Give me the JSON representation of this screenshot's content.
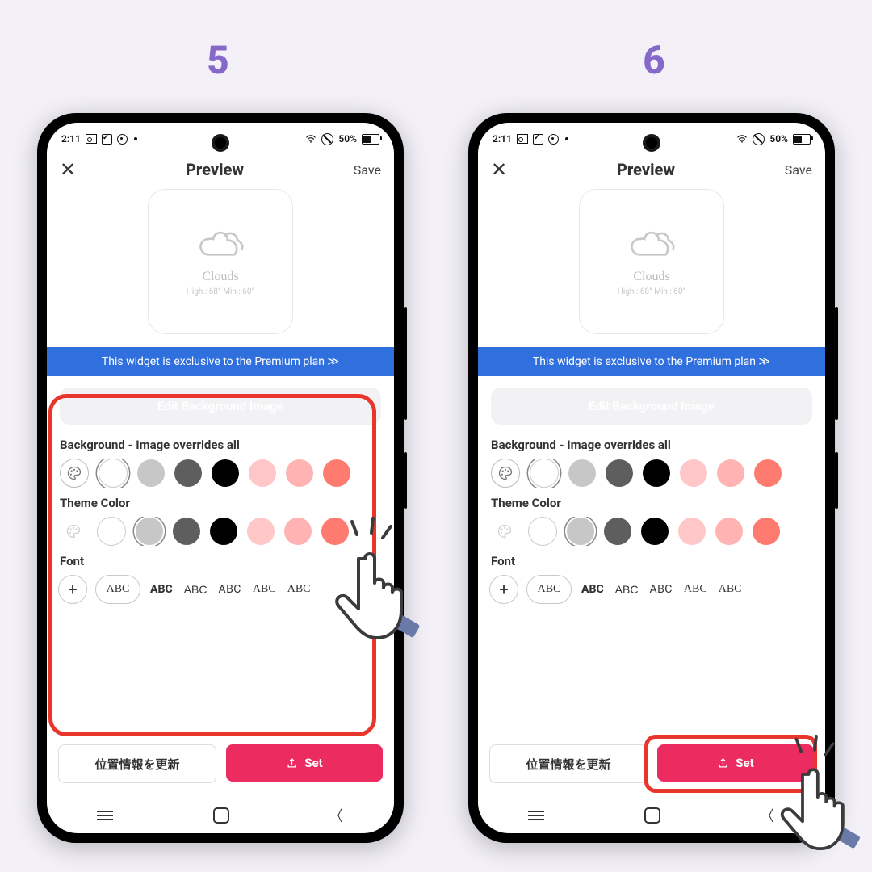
{
  "steps": {
    "left": "5",
    "right": "6"
  },
  "status": {
    "time": "2:11",
    "battery": "50%"
  },
  "header": {
    "title": "Preview",
    "save": "Save"
  },
  "widget": {
    "condition": "Clouds",
    "highlow": "High : 68° Min : 60°"
  },
  "banner": "This widget is exclusive to the Premium plan ≫",
  "editBg": "Edit Background Image",
  "sections": {
    "bg": "Background - Image overrides all",
    "theme": "Theme Color",
    "font": "Font"
  },
  "bgSwatches": [
    "palette",
    "#ffffff",
    "#c7c7c7",
    "#5e5e5e",
    "#000000",
    "#ffc7c7",
    "#ffb3b3",
    "#ff7a6f"
  ],
  "bgSelectedIndex": 1,
  "themeSwatches": [
    "palette-dim",
    "#ffffff",
    "#c7c7c7",
    "#5e5e5e",
    "#000000",
    "#ffc7c7",
    "#ffb3b3",
    "#ff7a6f"
  ],
  "themeSelectedIndex": 2,
  "fontChips": {
    "add": "+",
    "sample": "ABC"
  },
  "fontSamples": [
    "ABC",
    "ABC",
    "ABC",
    "ABC",
    "ABC"
  ],
  "actions": {
    "update": "位置情報を更新",
    "set": "Set"
  }
}
